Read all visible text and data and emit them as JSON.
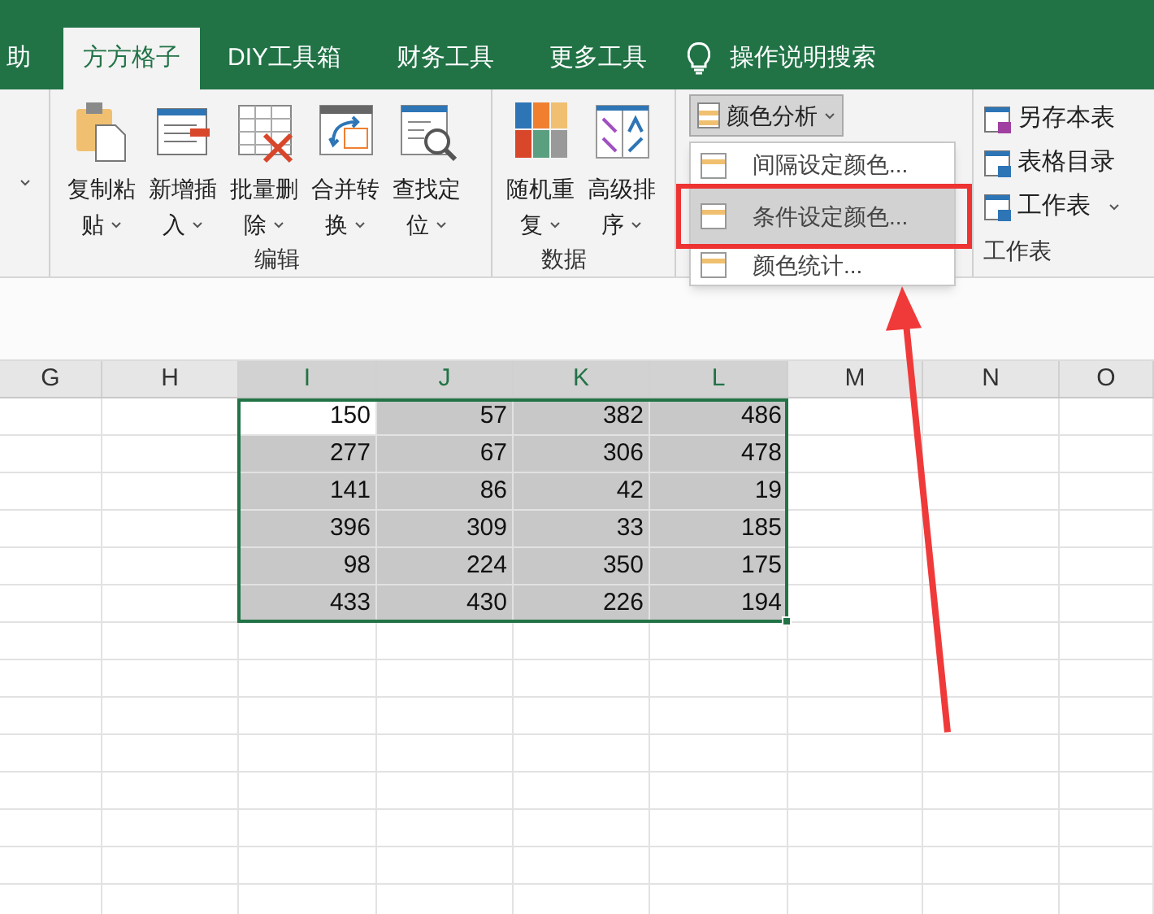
{
  "tabs": [
    {
      "label": "助",
      "selected": false
    },
    {
      "label": "方方格子",
      "selected": true
    },
    {
      "label": "DIY工具箱",
      "selected": false
    },
    {
      "label": "财务工具",
      "selected": false
    },
    {
      "label": "更多工具",
      "selected": false
    }
  ],
  "tell_me": "操作说明搜索",
  "ribbon_groups": [
    {
      "label": "编辑",
      "buttons": [
        {
          "line1": "复制粘",
          "line2": "贴"
        },
        {
          "line1": "新增插",
          "line2": "入"
        },
        {
          "line1": "批量删",
          "line2": "除"
        },
        {
          "line1": "合并转",
          "line2": "换"
        },
        {
          "line1": "查找定",
          "line2": "位"
        }
      ]
    },
    {
      "label": "数据",
      "buttons": [
        {
          "line1": "随机重",
          "line2": "复"
        },
        {
          "line1": "高级排",
          "line2": "序"
        }
      ]
    }
  ],
  "color_button": {
    "label": "颜色分析",
    "pressed": true
  },
  "worksheet_group": {
    "label": "工作表",
    "items": [
      {
        "label": "另存本表",
        "dropdown": false
      },
      {
        "label": "表格目录",
        "dropdown": false
      },
      {
        "label": "工作表",
        "dropdown": true
      }
    ]
  },
  "menu": [
    {
      "label": "间隔设定颜色...",
      "selected": false
    },
    {
      "label": "条件设定颜色...",
      "selected": true
    },
    {
      "label": "颜色统计...",
      "selected": false
    }
  ],
  "columns": [
    {
      "label": "G",
      "selected": false
    },
    {
      "label": "H",
      "selected": false
    },
    {
      "label": "I",
      "selected": true
    },
    {
      "label": "J",
      "selected": true
    },
    {
      "label": "K",
      "selected": true
    },
    {
      "label": "L",
      "selected": true
    },
    {
      "label": "M",
      "selected": false
    },
    {
      "label": "N",
      "selected": false
    },
    {
      "label": "O",
      "selected": false
    }
  ],
  "rows": [
    [
      "150",
      "57",
      "382",
      "486"
    ],
    [
      "277",
      "67",
      "306",
      "478"
    ],
    [
      "141",
      "86",
      "42",
      "19"
    ],
    [
      "396",
      "309",
      "33",
      "185"
    ],
    [
      "98",
      "224",
      "350",
      "175"
    ],
    [
      "433",
      "430",
      "226",
      "194"
    ]
  ]
}
